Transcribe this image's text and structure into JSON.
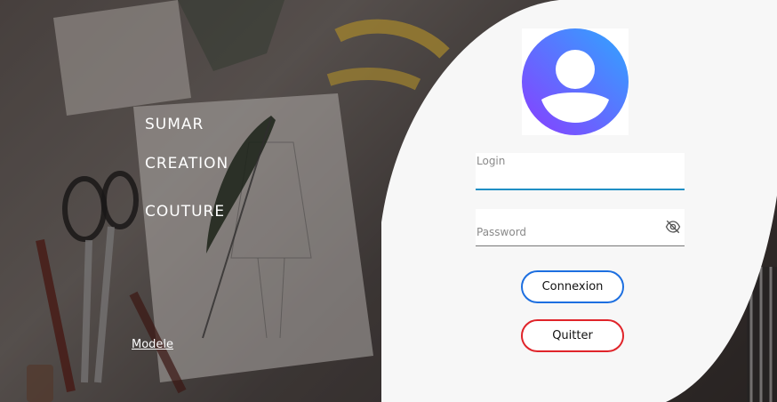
{
  "brand": {
    "line1": "SUMAR",
    "line2": "CREATION",
    "line3": "COUTURE"
  },
  "links": {
    "modele": "Modele"
  },
  "login_form": {
    "login_label": "Login",
    "password_label": "Password",
    "connexion_label": "Connexion",
    "quitter_label": "Quitter"
  },
  "icons": {
    "avatar": "user-avatar-icon",
    "password_toggle": "eye-off-icon"
  },
  "colors": {
    "panel_bg": "#f7f7f7",
    "login_underline": "#1f8fc4",
    "connexion_border": "#1d6fe0",
    "quitter_border": "#e0242a",
    "avatar_gradient_start": "#7b4dff",
    "avatar_gradient_end": "#2fa2ff"
  }
}
